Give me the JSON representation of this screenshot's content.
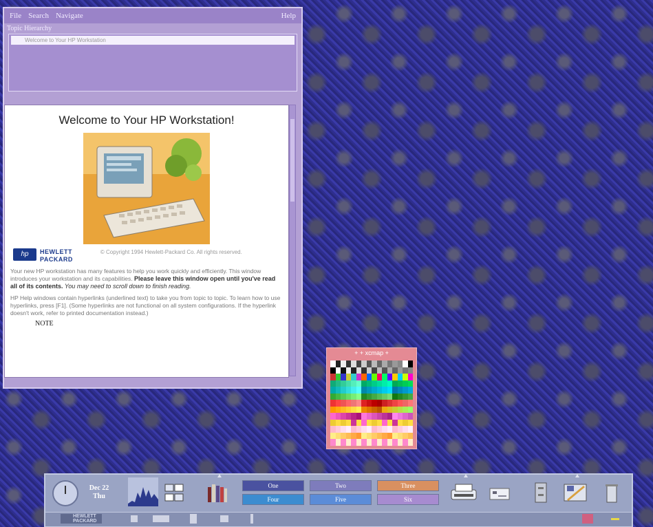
{
  "help_window": {
    "menu": {
      "file": "File",
      "search": "Search",
      "navigate": "Navigate",
      "help": "Help"
    },
    "topic_hierarchy_label": "Topic Hierarchy",
    "topic_selected": "Welcome to Your HP Workstation",
    "heading": "Welcome to Your HP Workstation!",
    "hp_logo_glyph": "hp",
    "hp_name_line1": "HEWLETT",
    "hp_name_line2": "PACKARD",
    "copyright": "© Copyright 1994 Hewlett-Packard Co. All rights reserved.",
    "para1": "Your new HP workstation has many features to help you work quickly and efficiently. This window introduces your workstation and its capabilities.",
    "para1_bold": "Please leave this window open until you've read all of its contents.",
    "para1_italic": "You may need to scroll down to finish reading.",
    "para2": "HP Help windows contain hyperlinks (underlined text) to take you from topic to topic. To learn how to use hyperlinks, press [F1]. (Some hyperlinks are not functional on all system configurations. If the hyperlink doesn't work, refer to printed documentation instead.)",
    "note": "NOTE"
  },
  "xcmap": {
    "title": "+ + xcmap +"
  },
  "front_panel": {
    "date_month_day": "Dec 22",
    "date_weekday": "Thu",
    "workspaces": [
      "One",
      "Two",
      "Three",
      "Four",
      "Five",
      "Six"
    ],
    "bottom_logo_line1": "HEWLETT",
    "bottom_logo_line2": "PACKARD"
  },
  "colors": {
    "window_bg": "#b3a0d4",
    "xcmap_bg": "#e48a94",
    "panel_bg": "#9aa4c4",
    "workspace_one": "#4a52a0",
    "workspace_two": "#7e7cbc",
    "workspace_three": "#d99060",
    "workspace_four": "#3c8cd0",
    "workspace_five": "#5b8cd8",
    "workspace_six": "#a78bd0"
  }
}
